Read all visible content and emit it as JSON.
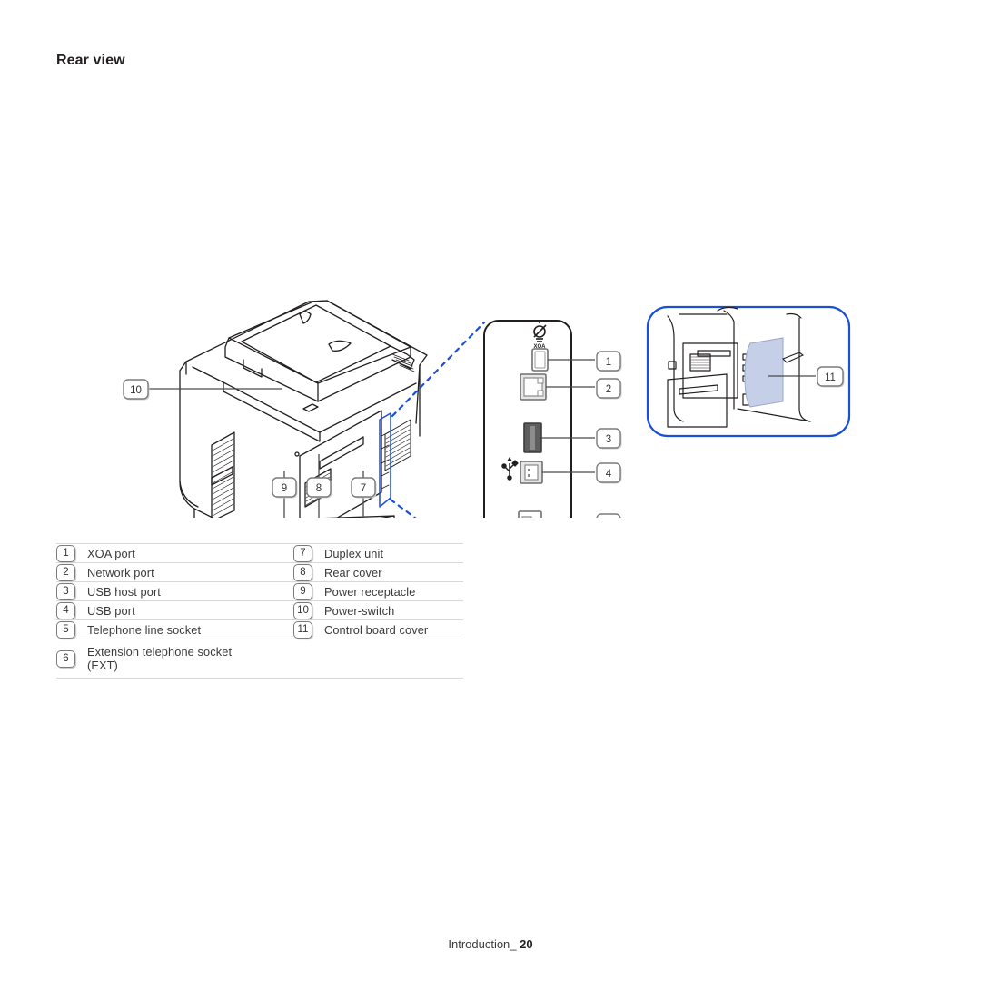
{
  "page": {
    "title": "Rear view",
    "footer_section": "Introduction_",
    "footer_page_number": "20"
  },
  "colors": {
    "accent_blue": "#1a4fd6",
    "panel_fill": "#c5cfe8",
    "line": "#231f20",
    "rule": "#d8d8d8",
    "chip_border": "#7b7b7b"
  },
  "figure": {
    "callouts": [
      {
        "id": "1",
        "name": "xoa-port"
      },
      {
        "id": "2",
        "name": "network-port"
      },
      {
        "id": "3",
        "name": "usb-host-port"
      },
      {
        "id": "4",
        "name": "usb-port"
      },
      {
        "id": "5",
        "name": "telephone-line-socket"
      },
      {
        "id": "6",
        "name": "extension-telephone-socket"
      },
      {
        "id": "7",
        "name": "duplex-unit"
      },
      {
        "id": "8",
        "name": "rear-cover"
      },
      {
        "id": "9",
        "name": "power-receptacle"
      },
      {
        "id": "10",
        "name": "power-switch"
      },
      {
        "id": "11",
        "name": "control-board-cover"
      }
    ],
    "port_panel_icon_label": "XOA"
  },
  "legend": {
    "rows": [
      {
        "left_num": "1",
        "left_label": "XOA port",
        "right_num": "7",
        "right_label": "Duplex unit"
      },
      {
        "left_num": "2",
        "left_label": "Network port",
        "right_num": "8",
        "right_label": "Rear cover"
      },
      {
        "left_num": "3",
        "left_label": "USB host port",
        "right_num": "9",
        "right_label": "Power receptacle"
      },
      {
        "left_num": "4",
        "left_label": "USB port",
        "right_num": "10",
        "right_label": "Power-switch"
      },
      {
        "left_num": "5",
        "left_label": "Telephone line socket",
        "right_num": "11",
        "right_label": "Control board cover"
      },
      {
        "left_num": "6",
        "left_label_line1": "Extension telephone socket",
        "left_label_line2": "(EXT)",
        "right_num": "",
        "right_label": ""
      }
    ]
  }
}
